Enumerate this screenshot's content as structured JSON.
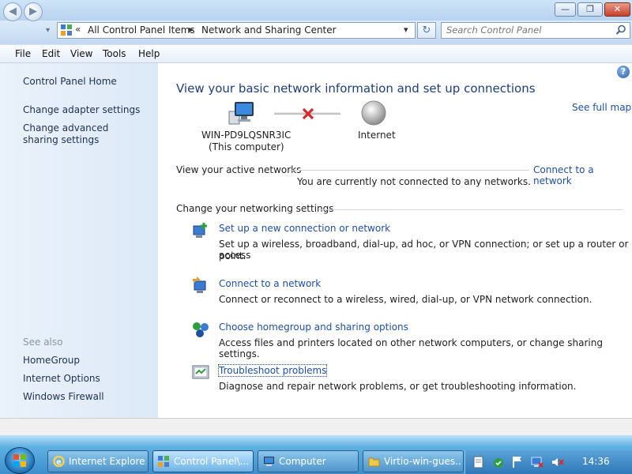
{
  "window": {
    "minimize_glyph": "—",
    "maximize_glyph": "❐",
    "close_glyph": "✕"
  },
  "navigation": {
    "back_glyph": "◀",
    "forward_glyph": "▶",
    "recent_glyph": "▾",
    "breadcrumb_prefix": "«",
    "breadcrumb": [
      "All Control Panel Items",
      "Network and Sharing Center"
    ],
    "breadcrumb_separator": "▶",
    "address_dropdown_glyph": "▾",
    "refresh_glyph": "↻",
    "search_placeholder": "Search Control Panel"
  },
  "menu": [
    "File",
    "Edit",
    "View",
    "Tools",
    "Help"
  ],
  "sidebar": {
    "home": "Control Panel Home",
    "tasks": [
      "Change adapter settings",
      "Change advanced sharing settings"
    ],
    "see_also_label": "See also",
    "see_also": [
      "HomeGroup",
      "Internet Options",
      "Windows Firewall"
    ]
  },
  "main": {
    "help_glyph": "?",
    "title": "View your basic network information and set up connections",
    "see_full_map": "See full map",
    "computer_name": "WIN-PD9LQSNR3IC",
    "computer_caption": "(This computer)",
    "internet_label": "Internet",
    "active_networks_label": "View your active networks",
    "connect_link": "Connect to a network",
    "not_connected_text": "You are currently not connected to any networks.",
    "change_settings_label": "Change your networking settings",
    "tasks": [
      {
        "title": "Set up a new connection or network",
        "desc_line1": "Set up a wireless, broadband, dial-up, ad hoc, or VPN connection; or set up a router or access",
        "desc_line2": "point."
      },
      {
        "title": "Connect to a network",
        "desc_line1": "Connect or reconnect to a wireless, wired, dial-up, or VPN network connection.",
        "desc_line2": ""
      },
      {
        "title": "Choose homegroup and sharing options",
        "desc_line1": "Access files and printers located on other network computers, or change sharing settings.",
        "desc_line2": ""
      },
      {
        "title": "Troubleshoot problems",
        "desc_line1": "Diagnose and repair network problems, or get troubleshooting information.",
        "desc_line2": ""
      }
    ]
  },
  "taskbar": {
    "items": [
      "Internet Explore...",
      "Control Panel\\...",
      "Computer",
      "Virtio-win-gues..."
    ],
    "active_index": 1,
    "clock": "14:36"
  },
  "colors": {
    "link": "#1e50a2",
    "title": "#1e3f7a",
    "disconnect_x": "#d62a2a"
  },
  "icons": [
    "back-icon",
    "forward-icon",
    "control-panel-icon",
    "refresh-icon",
    "search-icon",
    "help-icon",
    "computer-icon",
    "globe-icon",
    "disconnect-icon",
    "new-connection-icon",
    "connect-network-icon",
    "homegroup-icon",
    "troubleshoot-icon",
    "start-orb-icon",
    "ie-icon",
    "computer-taskbar-icon",
    "folder-icon",
    "action-center-icon",
    "flag-icon",
    "network-tray-icon",
    "volume-muted-icon"
  ]
}
